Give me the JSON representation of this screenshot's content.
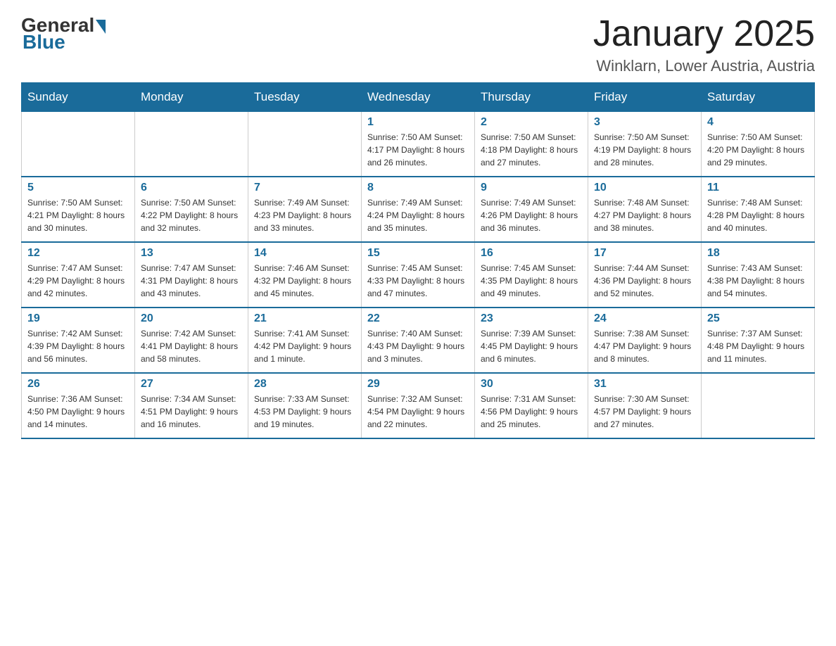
{
  "logo": {
    "general": "General",
    "blue": "Blue"
  },
  "title": "January 2025",
  "subtitle": "Winklarn, Lower Austria, Austria",
  "days_of_week": [
    "Sunday",
    "Monday",
    "Tuesday",
    "Wednesday",
    "Thursday",
    "Friday",
    "Saturday"
  ],
  "weeks": [
    [
      {
        "day": "",
        "info": ""
      },
      {
        "day": "",
        "info": ""
      },
      {
        "day": "",
        "info": ""
      },
      {
        "day": "1",
        "info": "Sunrise: 7:50 AM\nSunset: 4:17 PM\nDaylight: 8 hours\nand 26 minutes."
      },
      {
        "day": "2",
        "info": "Sunrise: 7:50 AM\nSunset: 4:18 PM\nDaylight: 8 hours\nand 27 minutes."
      },
      {
        "day": "3",
        "info": "Sunrise: 7:50 AM\nSunset: 4:19 PM\nDaylight: 8 hours\nand 28 minutes."
      },
      {
        "day": "4",
        "info": "Sunrise: 7:50 AM\nSunset: 4:20 PM\nDaylight: 8 hours\nand 29 minutes."
      }
    ],
    [
      {
        "day": "5",
        "info": "Sunrise: 7:50 AM\nSunset: 4:21 PM\nDaylight: 8 hours\nand 30 minutes."
      },
      {
        "day": "6",
        "info": "Sunrise: 7:50 AM\nSunset: 4:22 PM\nDaylight: 8 hours\nand 32 minutes."
      },
      {
        "day": "7",
        "info": "Sunrise: 7:49 AM\nSunset: 4:23 PM\nDaylight: 8 hours\nand 33 minutes."
      },
      {
        "day": "8",
        "info": "Sunrise: 7:49 AM\nSunset: 4:24 PM\nDaylight: 8 hours\nand 35 minutes."
      },
      {
        "day": "9",
        "info": "Sunrise: 7:49 AM\nSunset: 4:26 PM\nDaylight: 8 hours\nand 36 minutes."
      },
      {
        "day": "10",
        "info": "Sunrise: 7:48 AM\nSunset: 4:27 PM\nDaylight: 8 hours\nand 38 minutes."
      },
      {
        "day": "11",
        "info": "Sunrise: 7:48 AM\nSunset: 4:28 PM\nDaylight: 8 hours\nand 40 minutes."
      }
    ],
    [
      {
        "day": "12",
        "info": "Sunrise: 7:47 AM\nSunset: 4:29 PM\nDaylight: 8 hours\nand 42 minutes."
      },
      {
        "day": "13",
        "info": "Sunrise: 7:47 AM\nSunset: 4:31 PM\nDaylight: 8 hours\nand 43 minutes."
      },
      {
        "day": "14",
        "info": "Sunrise: 7:46 AM\nSunset: 4:32 PM\nDaylight: 8 hours\nand 45 minutes."
      },
      {
        "day": "15",
        "info": "Sunrise: 7:45 AM\nSunset: 4:33 PM\nDaylight: 8 hours\nand 47 minutes."
      },
      {
        "day": "16",
        "info": "Sunrise: 7:45 AM\nSunset: 4:35 PM\nDaylight: 8 hours\nand 49 minutes."
      },
      {
        "day": "17",
        "info": "Sunrise: 7:44 AM\nSunset: 4:36 PM\nDaylight: 8 hours\nand 52 minutes."
      },
      {
        "day": "18",
        "info": "Sunrise: 7:43 AM\nSunset: 4:38 PM\nDaylight: 8 hours\nand 54 minutes."
      }
    ],
    [
      {
        "day": "19",
        "info": "Sunrise: 7:42 AM\nSunset: 4:39 PM\nDaylight: 8 hours\nand 56 minutes."
      },
      {
        "day": "20",
        "info": "Sunrise: 7:42 AM\nSunset: 4:41 PM\nDaylight: 8 hours\nand 58 minutes."
      },
      {
        "day": "21",
        "info": "Sunrise: 7:41 AM\nSunset: 4:42 PM\nDaylight: 9 hours\nand 1 minute."
      },
      {
        "day": "22",
        "info": "Sunrise: 7:40 AM\nSunset: 4:43 PM\nDaylight: 9 hours\nand 3 minutes."
      },
      {
        "day": "23",
        "info": "Sunrise: 7:39 AM\nSunset: 4:45 PM\nDaylight: 9 hours\nand 6 minutes."
      },
      {
        "day": "24",
        "info": "Sunrise: 7:38 AM\nSunset: 4:47 PM\nDaylight: 9 hours\nand 8 minutes."
      },
      {
        "day": "25",
        "info": "Sunrise: 7:37 AM\nSunset: 4:48 PM\nDaylight: 9 hours\nand 11 minutes."
      }
    ],
    [
      {
        "day": "26",
        "info": "Sunrise: 7:36 AM\nSunset: 4:50 PM\nDaylight: 9 hours\nand 14 minutes."
      },
      {
        "day": "27",
        "info": "Sunrise: 7:34 AM\nSunset: 4:51 PM\nDaylight: 9 hours\nand 16 minutes."
      },
      {
        "day": "28",
        "info": "Sunrise: 7:33 AM\nSunset: 4:53 PM\nDaylight: 9 hours\nand 19 minutes."
      },
      {
        "day": "29",
        "info": "Sunrise: 7:32 AM\nSunset: 4:54 PM\nDaylight: 9 hours\nand 22 minutes."
      },
      {
        "day": "30",
        "info": "Sunrise: 7:31 AM\nSunset: 4:56 PM\nDaylight: 9 hours\nand 25 minutes."
      },
      {
        "day": "31",
        "info": "Sunrise: 7:30 AM\nSunset: 4:57 PM\nDaylight: 9 hours\nand 27 minutes."
      },
      {
        "day": "",
        "info": ""
      }
    ]
  ]
}
